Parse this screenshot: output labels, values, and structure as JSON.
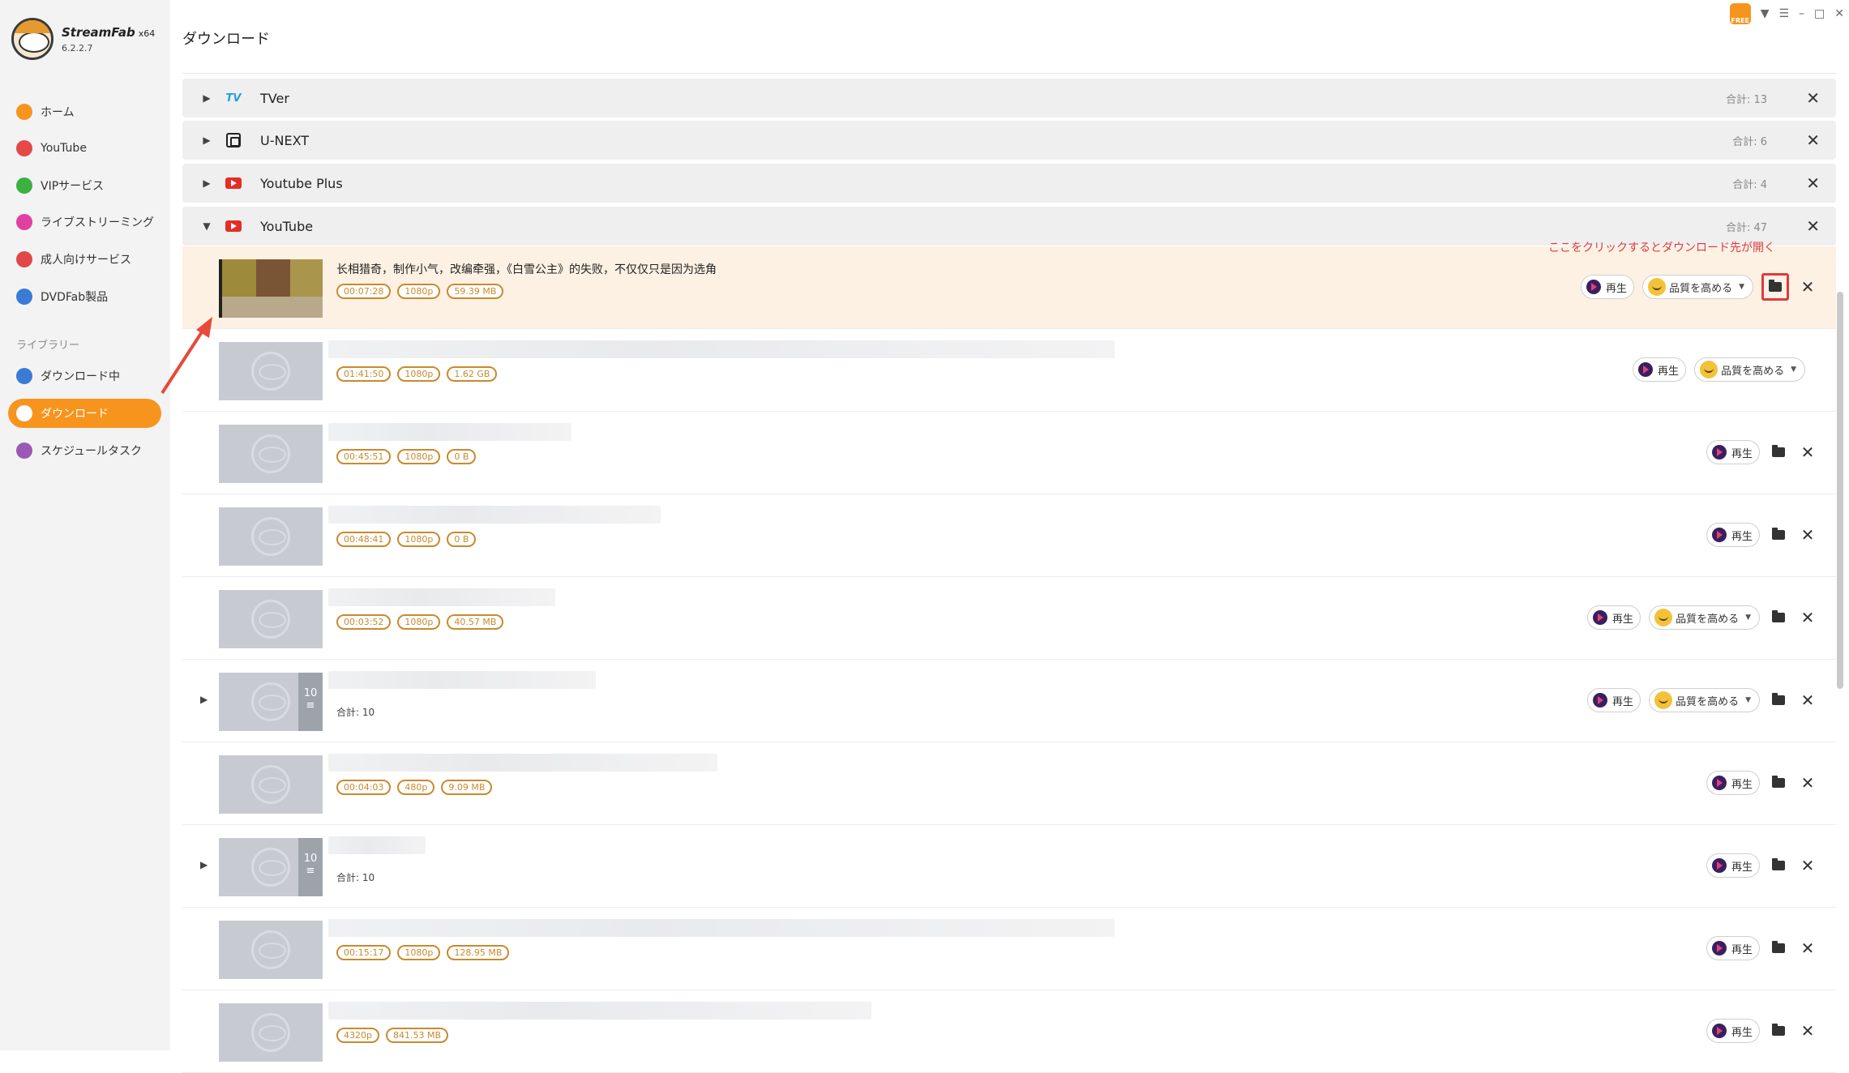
{
  "app": {
    "name": "StreamFab",
    "arch": "x64",
    "version": "6.2.2.7",
    "free_badge": "FREE"
  },
  "page_title": "ダウンロード",
  "sidebar": {
    "items": [
      {
        "label": "ホーム",
        "icon": "home-icon",
        "color": "#f7941d"
      },
      {
        "label": "YouTube",
        "icon": "youtube-icon",
        "color": "#e54848"
      },
      {
        "label": "VIPサービス",
        "icon": "key-icon",
        "color": "#3cb043"
      },
      {
        "label": "ライブストリーミング",
        "icon": "camera-icon",
        "color": "#e040a0"
      },
      {
        "label": "成人向けサービス",
        "icon": "adult-icon",
        "color": "#e04848"
      },
      {
        "label": "DVDFab製品",
        "icon": "dvdfab-icon",
        "color": "#3a7bd5"
      }
    ],
    "library_label": "ライブラリー",
    "library_items": [
      {
        "label": "ダウンロード中",
        "icon": "download-icon",
        "color": "#3a7bd5"
      },
      {
        "label": "ダウンロード",
        "icon": "folder-icon",
        "color": "#f7941d",
        "active": true
      },
      {
        "label": "スケジュールタスク",
        "icon": "schedule-icon",
        "color": "#9b59b6"
      }
    ]
  },
  "groups": [
    {
      "name": "TVer",
      "total": "合計: 13",
      "icon": "tver-icon"
    },
    {
      "name": "U-NEXT",
      "total": "合計: 6",
      "icon": "unext-icon"
    },
    {
      "name": "Youtube Plus",
      "total": "合計: 4",
      "icon": "youtube-icon"
    },
    {
      "name": "YouTube",
      "total": "合計: 47",
      "icon": "youtube-icon",
      "expanded": true
    }
  ],
  "annotation": "ここをクリックするとダウンロード先が開く",
  "buttons": {
    "play": "再生",
    "enhance": "品質を高める"
  },
  "items": [
    {
      "title": "长相猎奇，制作小气，改编牵强，《白雪公主》的失败，不仅仅只是因为选角",
      "tags": [
        "00:07:28",
        "1080p",
        "59.39 MB"
      ],
      "enhance": true,
      "folder": true,
      "close": true
    },
    {
      "title": "",
      "tags": [
        "01:41:50",
        "1080p",
        "1.62 GB"
      ],
      "enhance": true,
      "folder": false,
      "close": false
    },
    {
      "title": "",
      "tags": [
        "00:45:51",
        "1080p",
        "0 B"
      ],
      "enhance": false,
      "folder": true,
      "close": true
    },
    {
      "title": "",
      "tags": [
        "00:48:41",
        "1080p",
        "0 B"
      ],
      "enhance": false,
      "folder": true,
      "close": true
    },
    {
      "title": "",
      "tags": [
        "00:03:52",
        "1080p",
        "40.57 MB"
      ],
      "enhance": true,
      "folder": true,
      "close": true
    },
    {
      "title": "",
      "playlist_count": "10",
      "total": "合計: 10",
      "enhance": true,
      "folder": true,
      "close": true
    },
    {
      "title": "",
      "tags": [
        "00:04:03",
        "480p",
        "9.09 MB"
      ],
      "enhance": false,
      "folder": true,
      "close": true
    },
    {
      "title": "",
      "playlist_count": "10",
      "total": "合計: 10",
      "enhance": false,
      "folder": true,
      "close": true
    },
    {
      "title": "",
      "tags": [
        "00:15:17",
        "1080p",
        "128.95 MB"
      ],
      "enhance": false,
      "folder": true,
      "close": true
    },
    {
      "title": "",
      "tags": [
        "4320p",
        "841.53 MB"
      ],
      "enhance": false,
      "folder": true,
      "close": true
    }
  ]
}
